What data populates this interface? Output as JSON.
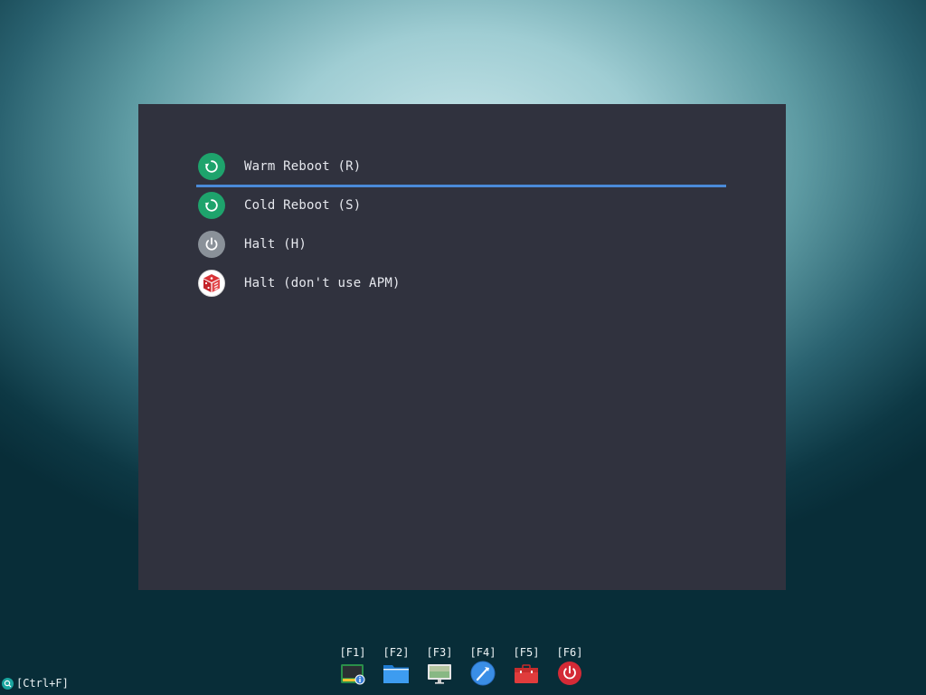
{
  "menu": {
    "items": [
      {
        "label": "Warm Reboot (R)",
        "icon": "reboot-icon",
        "selected": true
      },
      {
        "label": "Cold Reboot (S)",
        "icon": "reboot-icon",
        "selected": false
      },
      {
        "label": "Halt (H)",
        "icon": "power-icon",
        "selected": false
      },
      {
        "label": "Halt (don't use APM)",
        "icon": "dice-icon",
        "selected": false
      }
    ]
  },
  "taskbar": {
    "items": [
      {
        "key": "[F1]",
        "icon": "system-info-icon"
      },
      {
        "key": "[F2]",
        "icon": "folder-icon"
      },
      {
        "key": "[F3]",
        "icon": "monitor-icon"
      },
      {
        "key": "[F4]",
        "icon": "tools-icon"
      },
      {
        "key": "[F5]",
        "icon": "toolbox-icon"
      },
      {
        "key": "[F6]",
        "icon": "power-icon"
      }
    ]
  },
  "search": {
    "label": "[Ctrl+F]",
    "icon": "search-icon"
  },
  "colors": {
    "panel_bg": "#30323e",
    "selection_underline": "#4a8ad8",
    "reboot_green": "#1ea36c",
    "halt_gray": "#8a9199",
    "power_red": "#d42a36"
  }
}
